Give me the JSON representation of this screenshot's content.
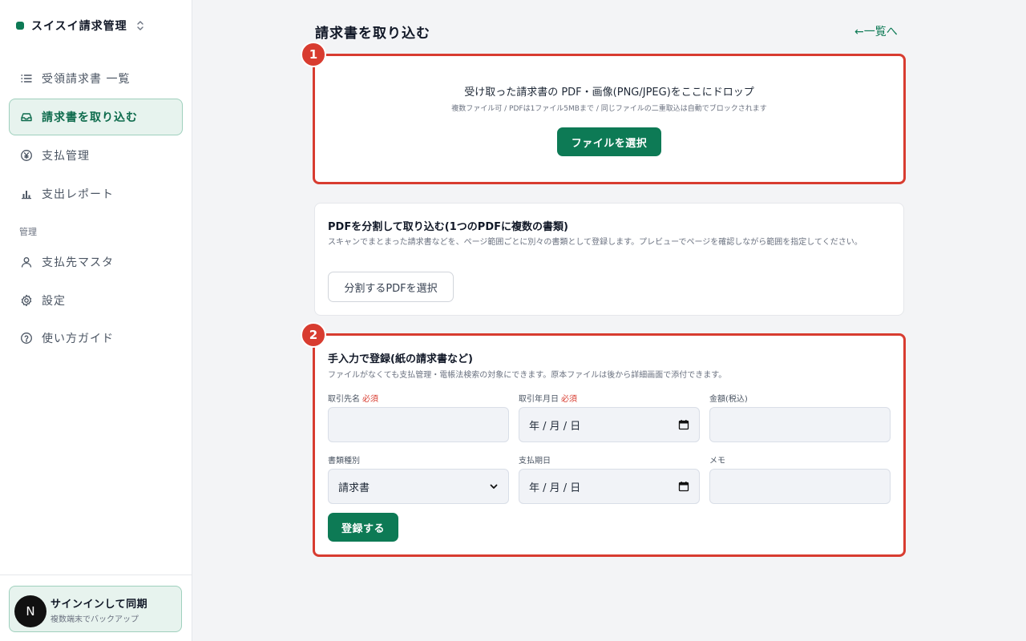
{
  "app": {
    "name": "スイスイ請求管理"
  },
  "sidebar": {
    "items": [
      {
        "label": "受領請求書 一覧",
        "icon": "list-icon"
      },
      {
        "label": "請求書を取り込む",
        "icon": "inbox-icon",
        "active": true
      },
      {
        "label": "支払管理",
        "icon": "yen-circle-icon"
      },
      {
        "label": "支出レポート",
        "icon": "bar-chart-icon"
      }
    ],
    "section_label": "管理",
    "admin_items": [
      {
        "label": "支払先マスタ",
        "icon": "user-icon"
      },
      {
        "label": "設定",
        "icon": "gear-icon"
      },
      {
        "label": "使い方ガイド",
        "icon": "help-circle-icon"
      }
    ],
    "signin": {
      "avatar": "N",
      "title": "サインインして同期",
      "subtitle": "複数端末でバックアップ"
    }
  },
  "header": {
    "title": "請求書を取り込む",
    "back_link": "←一覧へ"
  },
  "upload": {
    "step": "1",
    "title": "受け取った請求書の PDF・画像(PNG/JPEG)をここにドロップ",
    "subtitle": "複数ファイル可 / PDFは1ファイル5MBまで / 同じファイルの二重取込は自動でブロックされます",
    "button": "ファイルを選択"
  },
  "split": {
    "title": "PDFを分割して取り込む(1つのPDFに複数の書類)",
    "description": "スキャンでまとまった請求書などを、ページ範囲ごとに別々の書類として登録します。プレビューでページを確認しながら範囲を指定してください。",
    "button": "分割するPDFを選択"
  },
  "manual": {
    "step": "2",
    "title": "手入力で登録(紙の請求書など)",
    "description": "ファイルがなくても支払管理・電帳法検索の対象にできます。原本ファイルは後から詳細画面で添付できます。",
    "required_label": "必須",
    "fields": {
      "vendor": {
        "label": "取引先名",
        "value": ""
      },
      "date": {
        "label": "取引年月日",
        "value": "年 / 月 / 日"
      },
      "amount": {
        "label": "金額(税込)",
        "value": ""
      },
      "doc_type": {
        "label": "書類種別",
        "value": "請求書"
      },
      "due_date": {
        "label": "支払期日",
        "value": "年 / 月 / 日"
      },
      "memo": {
        "label": "メモ",
        "value": ""
      }
    },
    "submit": "登録する"
  },
  "colors": {
    "accent": "#0d7a55",
    "highlight": "#d83c30",
    "active_bg": "#e7f3ee"
  }
}
